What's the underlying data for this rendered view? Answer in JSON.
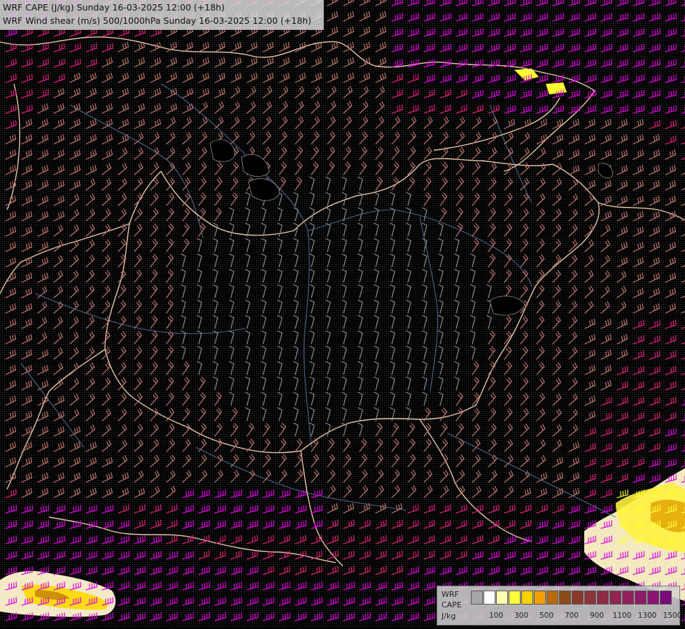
{
  "titles": {
    "line1": "WRF CAPE (J/kg) Sunday 16-03-2025 12:00 (+18h)",
    "line2": "WRF Wind shear (m/s) 500/1000hPa Sunday 16-03-2025 12:00 (+18h)"
  },
  "legend": {
    "labels": [
      "WRF",
      "CAPE",
      "J/kg"
    ],
    "colors": [
      "#a6a6a6",
      "#ffffff",
      "#ffffb0",
      "#ffff3a",
      "#ffd200",
      "#f0a000",
      "#b86a10",
      "#8a4a1a",
      "#8a3a28",
      "#8c3438",
      "#8e2c44",
      "#902450",
      "#92205c",
      "#901a68",
      "#8a1472",
      "#7a0c78"
    ],
    "ticks": [
      "100",
      "300",
      "500",
      "700",
      "900",
      "1100",
      "1300",
      "1500"
    ]
  },
  "colors": {
    "background": "#000000",
    "border": "#e8c8a8",
    "river": "#5a7aa8",
    "barb_weak": "#909090",
    "barb_mid": "#c07870",
    "barb_strong": "#e0207c",
    "barb_very_strong": "#e000e0",
    "cape_yellow": "#ffff33"
  }
}
